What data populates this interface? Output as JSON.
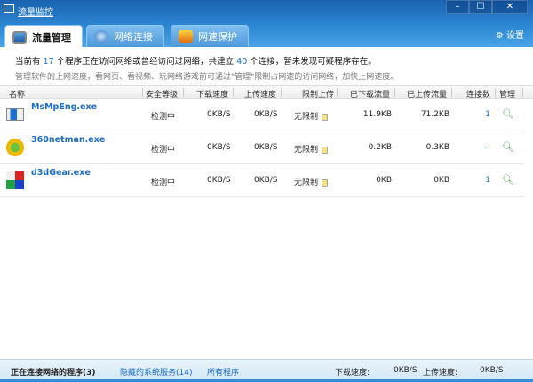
{
  "window": {
    "title": "流量监控",
    "minimize": "–",
    "maximize": "☐",
    "close": "✕"
  },
  "tabs": [
    {
      "label": "流量管理",
      "icon": "monitor-icon"
    },
    {
      "label": "网络连接",
      "icon": "globe-icon"
    },
    {
      "label": "网速保护",
      "icon": "shield-bolt-icon"
    }
  ],
  "settings_label": "设置",
  "info": {
    "pre": "当前有 ",
    "programs": "17",
    "mid": " 个程序正在访问网络或曾经访问过网络，共建立 ",
    "connections": "40",
    "post": " 个连接，暂未发现可疑程序存在。",
    "hint": "管理软件的上网速度，看网页、看视频、玩网络游戏前可通过\"管理\"限制占网速的访问网络，加快上网速度。"
  },
  "columns": [
    "名称",
    "安全等级",
    "下载速度",
    "上传速度",
    "限制上传",
    "已下载流量",
    "已上传流量",
    "连接数",
    "管理"
  ],
  "rows": [
    {
      "name": "MsMpEng.exe",
      "security": "检测中",
      "down": "0KB/S",
      "up": "0KB/S",
      "limit": "无限制",
      "downloaded": "11.9KB",
      "uploaded": "71.2KB",
      "conns": "1"
    },
    {
      "name": "360netman.exe",
      "security": "检测中",
      "down": "0KB/S",
      "up": "0KB/S",
      "limit": "无限制",
      "downloaded": "0.2KB",
      "uploaded": "0.3KB",
      "conns": "--"
    },
    {
      "name": "d3dGear.exe",
      "security": "检测中",
      "down": "0KB/S",
      "up": "0KB/S",
      "limit": "无限制",
      "downloaded": "0KB",
      "uploaded": "0KB",
      "conns": "1"
    }
  ],
  "bottom": {
    "active": "正在连接网络的程序(3)",
    "hidden": "隐藏的系统服务(14)",
    "all": "所有程序",
    "down_label": "下载速度:",
    "down_value": "0KB/S",
    "up_label": "上传速度:",
    "up_value": "0KB/S"
  }
}
